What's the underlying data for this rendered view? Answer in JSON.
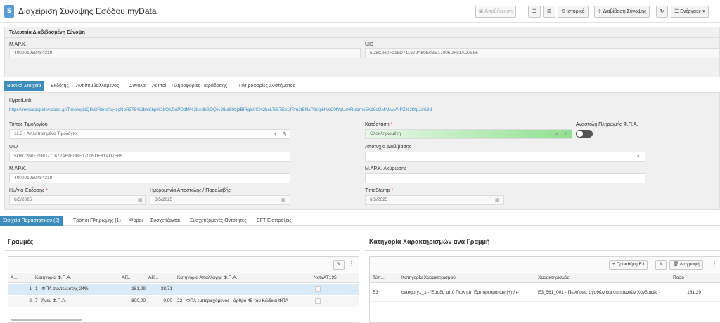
{
  "app": {
    "icon": "$",
    "title": "Διαχείριση Σύνοψης Εσόδου myData"
  },
  "toolbar": {
    "save": "Αποθήκευση",
    "history": "Ιστορικό",
    "read_summary": "Διαβίβαση Σύνοψης",
    "actions": "Ενέργειες"
  },
  "last_read": {
    "title": "Τελευταία Διαβιβασμένη Σύνοψη",
    "mark_label": "Μ.ΑΡ.Κ.",
    "mark_value": "400001950484319",
    "uid_label": "UID",
    "uid_value": "5D8C260F218D711672A69E0BE17005DF81AD7586"
  },
  "main_tabs": [
    "Βασικά Στοιχεία",
    "Εκδότης",
    "Αντισυμβαλλόμενος",
    "Σύνολα",
    "Λοιποί",
    "Πληροφορίες Παράδοσης",
    "Πληροφορίες Συστήματος"
  ],
  "basic": {
    "hyperlink_label": "HyperLink",
    "hyperlink_value": "https://mydataapidev.aade.gr/TimologioQR/QRInfo?q=zgNoR3T5%2bYKbp%2bQzZtoPDdM%2bAdkGOQ%2fLd8HzjzBIRgis0C%2bcLTc57Eb1jfRm3tENaP9sfpHlWC0fYqUdvRtdzmo5Kd9sQMALwVNPZ%2fXpJs%3d",
    "invoice_type_label": "Τύπος Τιμολογίου",
    "invoice_type_value": "11.3 - Απλοποιημένο Τιμολόγιο",
    "status_label": "Κατάσταση",
    "status_value": "Ολοκληρωμένη",
    "vat_suspend_label": "Αναστολή Πληρωμής Φ.Π.Α.",
    "uid_label": "UID",
    "uid_value": "5D8C260F218D711672A69E0BE17005DF81AD7586",
    "failure_label": "Αποτυχία Διαβίβασης",
    "failure_value": "",
    "mark_label": "Μ.ΑΡ.Κ.",
    "mark_value": "400001950484319",
    "mark_cancel_label": "Μ.ΑΡ.Κ. Ακύρωσης",
    "mark_cancel_value": "",
    "issue_date_label": "Ημ/νία Έκδοσης",
    "issue_date_value": "6/5/2025",
    "send_date_label": "Ημερομηνία Αποστολής / Παραλαβής",
    "send_date_value": "6/5/2025",
    "timestamp_label": "TimeStamp",
    "timestamp_value": "6/5/2025"
  },
  "sub_tabs": [
    "Στοιχεία Παραστατικού (2)",
    "Τρόποι Πληρωμής (1)",
    "Φόροι",
    "Συσχετίζονται",
    "Συσχετιζόμενες Οντότητες",
    "EFT Εισπράξεις"
  ],
  "lines": {
    "title": "Γραμμές",
    "headers": [
      "Α...",
      "Κατηγορία Φ.Π.Α.",
      "Αξί...",
      "Αξί...",
      "Κατηγορία Απαλλαγής Φ.Π.Α.",
      "NotVAT195"
    ],
    "rows": [
      {
        "aa": "1",
        "vat_cat": "1 - ΦΠΑ συντελεστής 24%",
        "v1": "161,29",
        "v2": "38,71",
        "exempt": ""
      },
      {
        "aa": "2",
        "vat_cat": "7 - Άνευ Φ.Π.Α.",
        "v1": "800,00",
        "v2": "0,00",
        "exempt": "22 - ΦΠΑ εμπεριεχόμενος - άρθρο 45 του Κώδικα ΦΠΑ"
      }
    ]
  },
  "classifications": {
    "title": "Κατηγορία Χαρακτηρισμών ανά Γραμμή",
    "add_button": "Προσθήκη Ε3",
    "delete_button": "Διαγραφή",
    "headers": [
      "Τύπ...",
      "Κατηγορία Χαρακτηρισμού",
      "Χαρακτηρισμός",
      "Ποσό"
    ],
    "rows": [
      {
        "type": "E3",
        "category": "category1_1 - Έσοδα από Πώληση Εμπορευμάτων (+) / (-)",
        "char": "E3_561_001 - Πωλήσεις αγαθών και υπηρεσιών Χονδρικές -",
        "amount": "161,29"
      }
    ]
  },
  "colors": {
    "accent": "#3c8dbc",
    "status_green": "#90e090"
  }
}
